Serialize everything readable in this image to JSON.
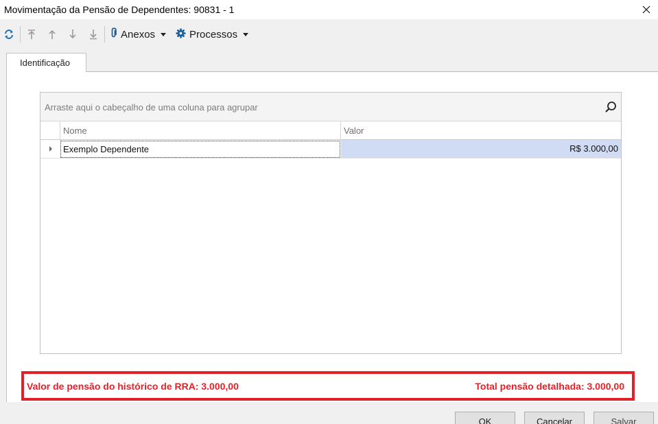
{
  "window": {
    "title": "Movimentação da Pensão de Dependentes: 90831 - 1",
    "close_icon": "close-icon"
  },
  "toolbar": {
    "refresh_icon": "refresh-icon",
    "nav_icons": [
      "move-first-icon",
      "move-up-icon",
      "move-down-icon",
      "move-last-icon"
    ],
    "anexos_label": "Anexos",
    "processos_label": "Processos"
  },
  "tabs": [
    {
      "label": "Identificação",
      "selected": true
    }
  ],
  "grid": {
    "group_hint": "Arraste aqui o cabeçalho de uma coluna para agrupar",
    "columns": [
      "Nome",
      "Valor"
    ],
    "rows": [
      {
        "nome": "Exemplo Dependente",
        "valor": "R$ 3.000,00"
      }
    ]
  },
  "summary": {
    "historico_rra": "Valor de pensão do histórico de RRA: 3.000,00",
    "total_detalhada": "Total pensão detalhada: 3.000,00",
    "highlight_color": "#e3202a"
  },
  "buttons": {
    "ok": "OK",
    "cancel": "Cancelar",
    "save": "Salvar"
  },
  "colors": {
    "accent": "#1a6fb5",
    "selected_cell": "#cfdcf3",
    "alert_text": "#ee1c25"
  }
}
